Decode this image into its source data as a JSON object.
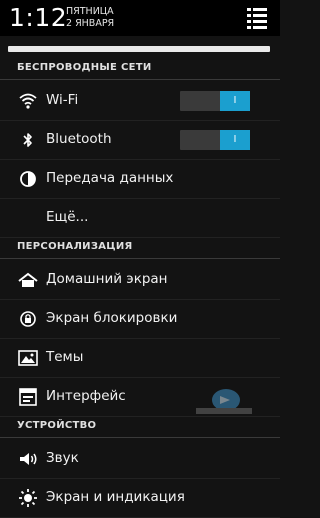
{
  "status_bar": {
    "time": "1:12",
    "day": "ПЯТНИЦА",
    "date": "2 ЯНВАРЯ",
    "quick_settings_icon": "quick-settings-icon"
  },
  "sections": {
    "wireless": {
      "title": "БЕСПРОВОДНЫЕ СЕТИ",
      "items": [
        {
          "label": "Wi-Fi",
          "icon": "wifi-icon",
          "toggle": "I"
        },
        {
          "label": "Bluetooth",
          "icon": "bluetooth-icon",
          "toggle": "I"
        },
        {
          "label": "Передача данных",
          "icon": "data-usage-icon"
        },
        {
          "label": "Ещё..."
        }
      ]
    },
    "personal": {
      "title": "ПЕРСОНАЛИЗАЦИЯ",
      "items": [
        {
          "label": "Домашний экран",
          "icon": "home-icon"
        },
        {
          "label": "Экран блокировки",
          "icon": "lock-icon"
        },
        {
          "label": "Темы",
          "icon": "themes-icon"
        },
        {
          "label": "Интерфейс",
          "icon": "interface-icon"
        }
      ]
    },
    "device": {
      "title": "УСТРОЙСТВО",
      "items": [
        {
          "label": "Звук",
          "icon": "sound-icon"
        },
        {
          "label": "Экран и индикация",
          "icon": "display-icon"
        }
      ]
    }
  },
  "colors": {
    "accent": "#1b9fcf",
    "background": "#131313",
    "toggle_off": "#3a3a3a"
  }
}
